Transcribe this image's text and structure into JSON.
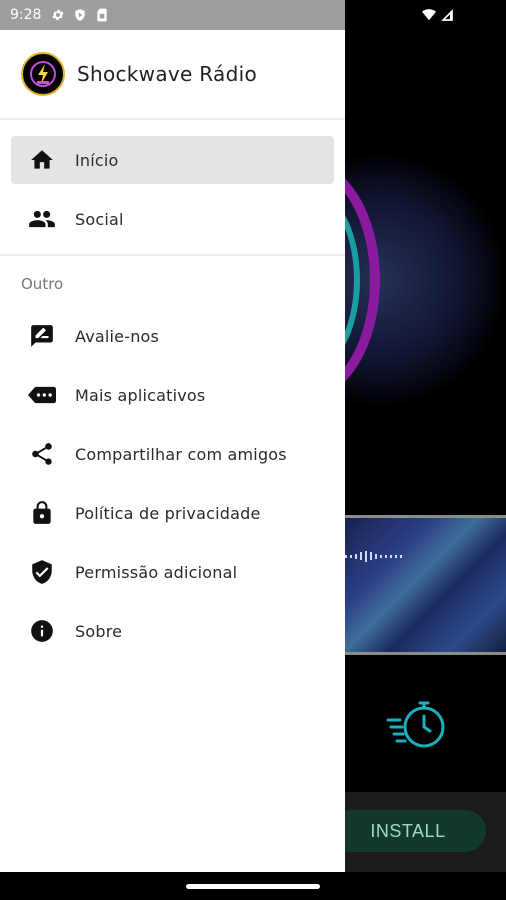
{
  "status_bar": {
    "time": "9:28",
    "icons": [
      "settings-icon",
      "play-protect-icon",
      "sim-card-icon",
      "wifi-icon",
      "signal-icon"
    ]
  },
  "drawer": {
    "app_title": "Shockwave Rádio",
    "main_items": [
      {
        "label": "Início",
        "icon": "home-icon",
        "active": true
      },
      {
        "label": "Social",
        "icon": "people-icon",
        "active": false
      }
    ],
    "section_title": "Outro",
    "other_items": [
      {
        "label": "Avalie-nos",
        "icon": "rate-review-icon"
      },
      {
        "label": "Mais aplicativos",
        "icon": "more-apps-icon"
      },
      {
        "label": "Compartilhar com amigos",
        "icon": "share-icon"
      },
      {
        "label": "Política de privacidade",
        "icon": "lock-icon"
      },
      {
        "label": "Permissão adicional",
        "icon": "verified-shield-icon"
      },
      {
        "label": "Sobre",
        "icon": "info-icon"
      }
    ]
  },
  "background": {
    "install_label": "INSTALL"
  },
  "colors": {
    "accent_ring": "#8a1aa0",
    "teal": "#1a9ea0",
    "install_bg": "#123a2c"
  }
}
